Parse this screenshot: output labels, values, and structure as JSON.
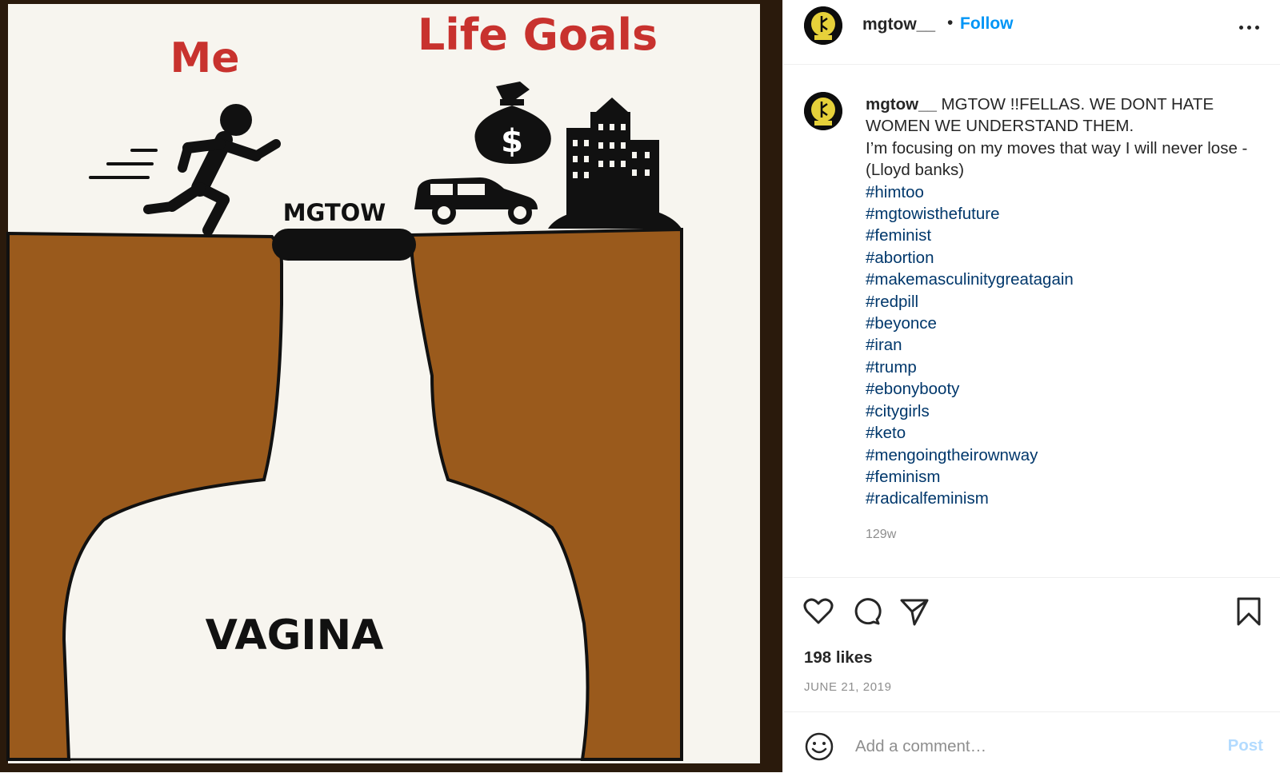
{
  "media": {
    "meme": {
      "label_me": "Me",
      "label_life_goals": "Life Goals",
      "label_bridge": "MGTOW",
      "label_pit": "VAGINA",
      "money_symbol": "$"
    }
  },
  "header": {
    "username": "mgtow__",
    "separator": "•",
    "follow_label": "Follow",
    "more_icon": "more-horizontal-icon"
  },
  "caption": {
    "username": "mgtow__",
    "lines": [
      " MGTOW !!FELLAS. WE DONT HATE WOMEN WE UNDERSTAND THEM.",
      "I’m focusing on my moves that way I will never lose - (Lloyd banks)"
    ],
    "hashtags": [
      "#himtoo",
      "#mgtowisthefuture",
      "#feminist",
      "#abortion",
      "#makemasculinitygreatagain",
      "#redpill",
      "#beyonce",
      "#iran",
      "#trump",
      "#ebonybooty",
      "#citygirls",
      "#keto",
      "#mengoingtheirownway",
      "#feminism",
      "#radicalfeminism"
    ],
    "age": "129w"
  },
  "actions": {
    "icons": [
      "heart-icon",
      "comment-icon",
      "share-icon",
      "bookmark-icon"
    ],
    "likes": "198 likes",
    "date": "JUNE 21, 2019"
  },
  "comment": {
    "emoji_icon": "emoji-icon",
    "placeholder": "Add a comment…",
    "post_label": "Post"
  },
  "colors": {
    "link_blue": "#0095f6",
    "hashtag_blue": "#00376b",
    "muted_gray": "#8e8e8e",
    "post_disabled": "#b3dbff",
    "meme_red": "#c8322e",
    "meme_brown": "#9a5a1c"
  }
}
